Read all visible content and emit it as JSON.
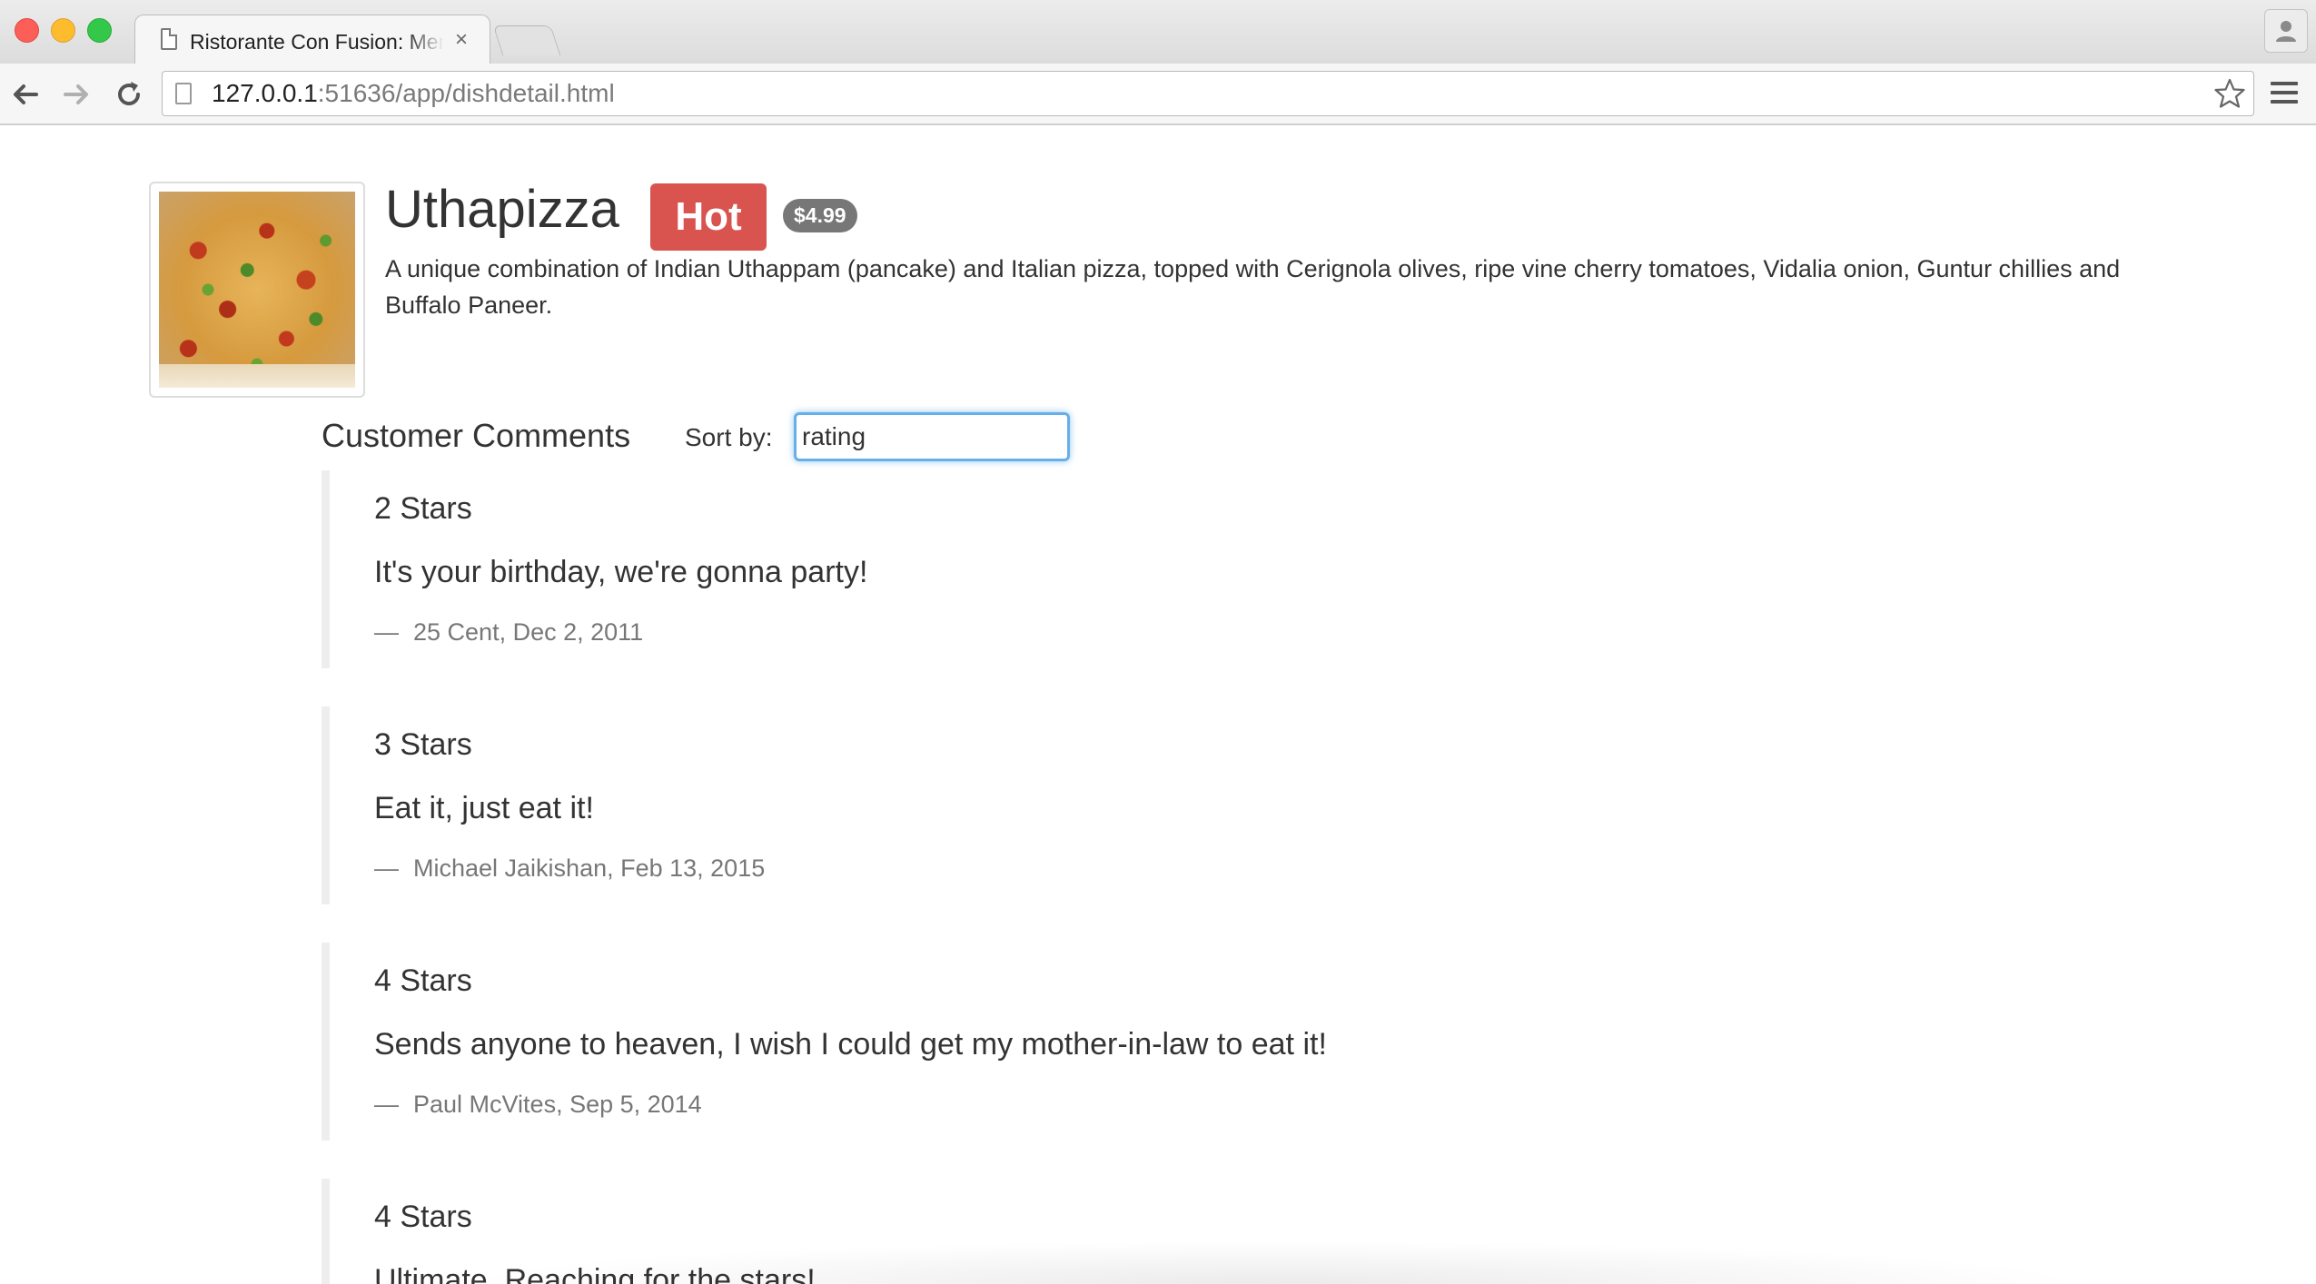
{
  "browser": {
    "tab_title": "Ristorante Con Fusion: Menu",
    "tab_close": "×",
    "url_host": "127.0.0.1",
    "url_rest": ":51636/app/dishdetail.html"
  },
  "dish": {
    "name": "Uthapizza",
    "label": "Hot",
    "price": "$4.99",
    "description": "A unique combination of Indian Uthappam (pancake) and Italian pizza, topped with Cerignola olives, ripe vine cherry tomatoes, Vidalia onion, Guntur chillies and Buffalo Paneer.",
    "image_icon": "pizza-image"
  },
  "comments_section": {
    "heading": "Customer Comments",
    "sort_label": "Sort by:",
    "sort_value": "rating"
  },
  "comments": [
    {
      "stars": "2 Stars",
      "text": "It's your birthday, we're gonna party!",
      "dash": "—",
      "byline": "25 Cent, Dec 2, 2011"
    },
    {
      "stars": "3 Stars",
      "text": "Eat it, just eat it!",
      "dash": "—",
      "byline": "Michael Jaikishan, Feb 13, 2015"
    },
    {
      "stars": "4 Stars",
      "text": "Sends anyone to heaven, I wish I could get my mother-in-law to eat it!",
      "dash": "—",
      "byline": "Paul McVites, Sep 5, 2014"
    },
    {
      "stars": "4 Stars",
      "text": "Ultimate, Reaching for the stars!",
      "dash": "",
      "byline": ""
    }
  ],
  "colors": {
    "hot_label": "#d9534f",
    "price_badge": "#777777",
    "input_focus": "#66afe9"
  }
}
